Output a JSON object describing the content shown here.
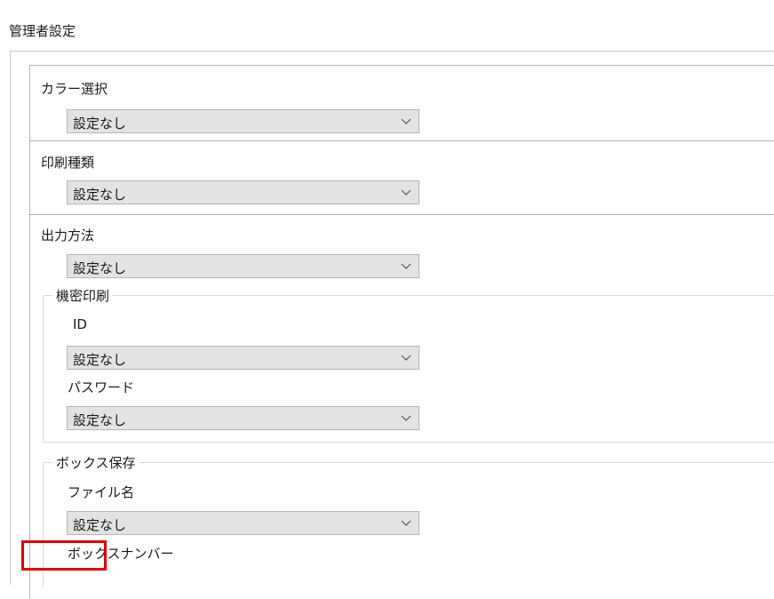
{
  "window": {
    "title": "管理者設定"
  },
  "sections": {
    "color": {
      "label": "カラー選択",
      "value": "設定なし"
    },
    "print_type": {
      "label": "印刷種類",
      "value": "設定なし"
    },
    "output": {
      "label": "出力方法",
      "value": "設定なし"
    }
  },
  "secure_print": {
    "group_label": "機密印刷",
    "id_label": "ID",
    "id_value": "設定なし",
    "password_label": "パスワード",
    "password_value": "設定なし"
  },
  "box_save": {
    "group_label": "ボックス保存",
    "file_name_label": "ファイル名",
    "file_name_value": "設定なし",
    "box_number_label": "ボックスナンバー"
  },
  "annotation": {
    "highlight_color": "#e00000"
  }
}
